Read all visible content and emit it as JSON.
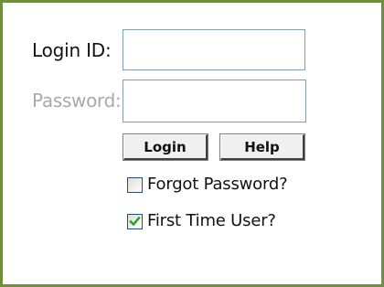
{
  "form": {
    "login_id_label": "Login ID:",
    "login_id_value": "",
    "password_label": "Password:",
    "password_value": "",
    "login_button": "Login",
    "help_button": "Help",
    "forgot_password": {
      "label": "Forgot Password?",
      "checked": false
    },
    "first_time_user": {
      "label": "First Time User?",
      "checked": true
    }
  },
  "colors": {
    "panel_border": "#6f8f3c",
    "input_border": "#7f9db9",
    "disabled_label": "#a9a9a9",
    "check_mark": "#21a121"
  }
}
